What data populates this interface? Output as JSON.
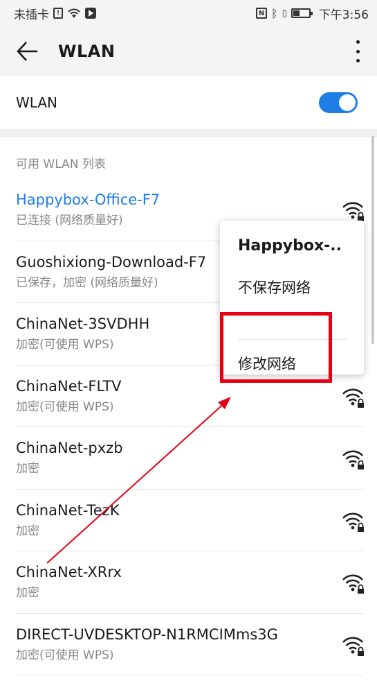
{
  "statusbar": {
    "carrier": "未插卡",
    "time": "下午3:56"
  },
  "appbar": {
    "title": "WLAN"
  },
  "toggle": {
    "label": "WLAN",
    "enabled": true,
    "accent": "#1e7ee6"
  },
  "section": {
    "title": "可用 WLAN 列表"
  },
  "networks": [
    {
      "name": "Happybox-Office-F7",
      "status": "已连接 (网络质量好)",
      "connected": true
    },
    {
      "name": "Guoshixiong-Download-F7",
      "status": "已保存，加密 (网络质量好)",
      "connected": false
    },
    {
      "name": "ChinaNet-3SVDHH",
      "status": "加密(可使用 WPS)",
      "connected": false
    },
    {
      "name": "ChinaNet-FLTV",
      "status": "加密(可使用 WPS)",
      "connected": false
    },
    {
      "name": "ChinaNet-pxzb",
      "status": "加密",
      "connected": false
    },
    {
      "name": "ChinaNet-TezK",
      "status": "加密",
      "connected": false
    },
    {
      "name": "ChinaNet-XRrx",
      "status": "加密",
      "connected": false
    },
    {
      "name": "DIRECT-UVDESKTOP-N1RMCIMms3G",
      "status": "加密(可使用 WPS)",
      "connected": false
    }
  ],
  "popup": {
    "title": "Happybox-..",
    "forget": "不保存网络",
    "modify": "修改网络"
  },
  "annotation": {
    "color": "#e60012"
  }
}
